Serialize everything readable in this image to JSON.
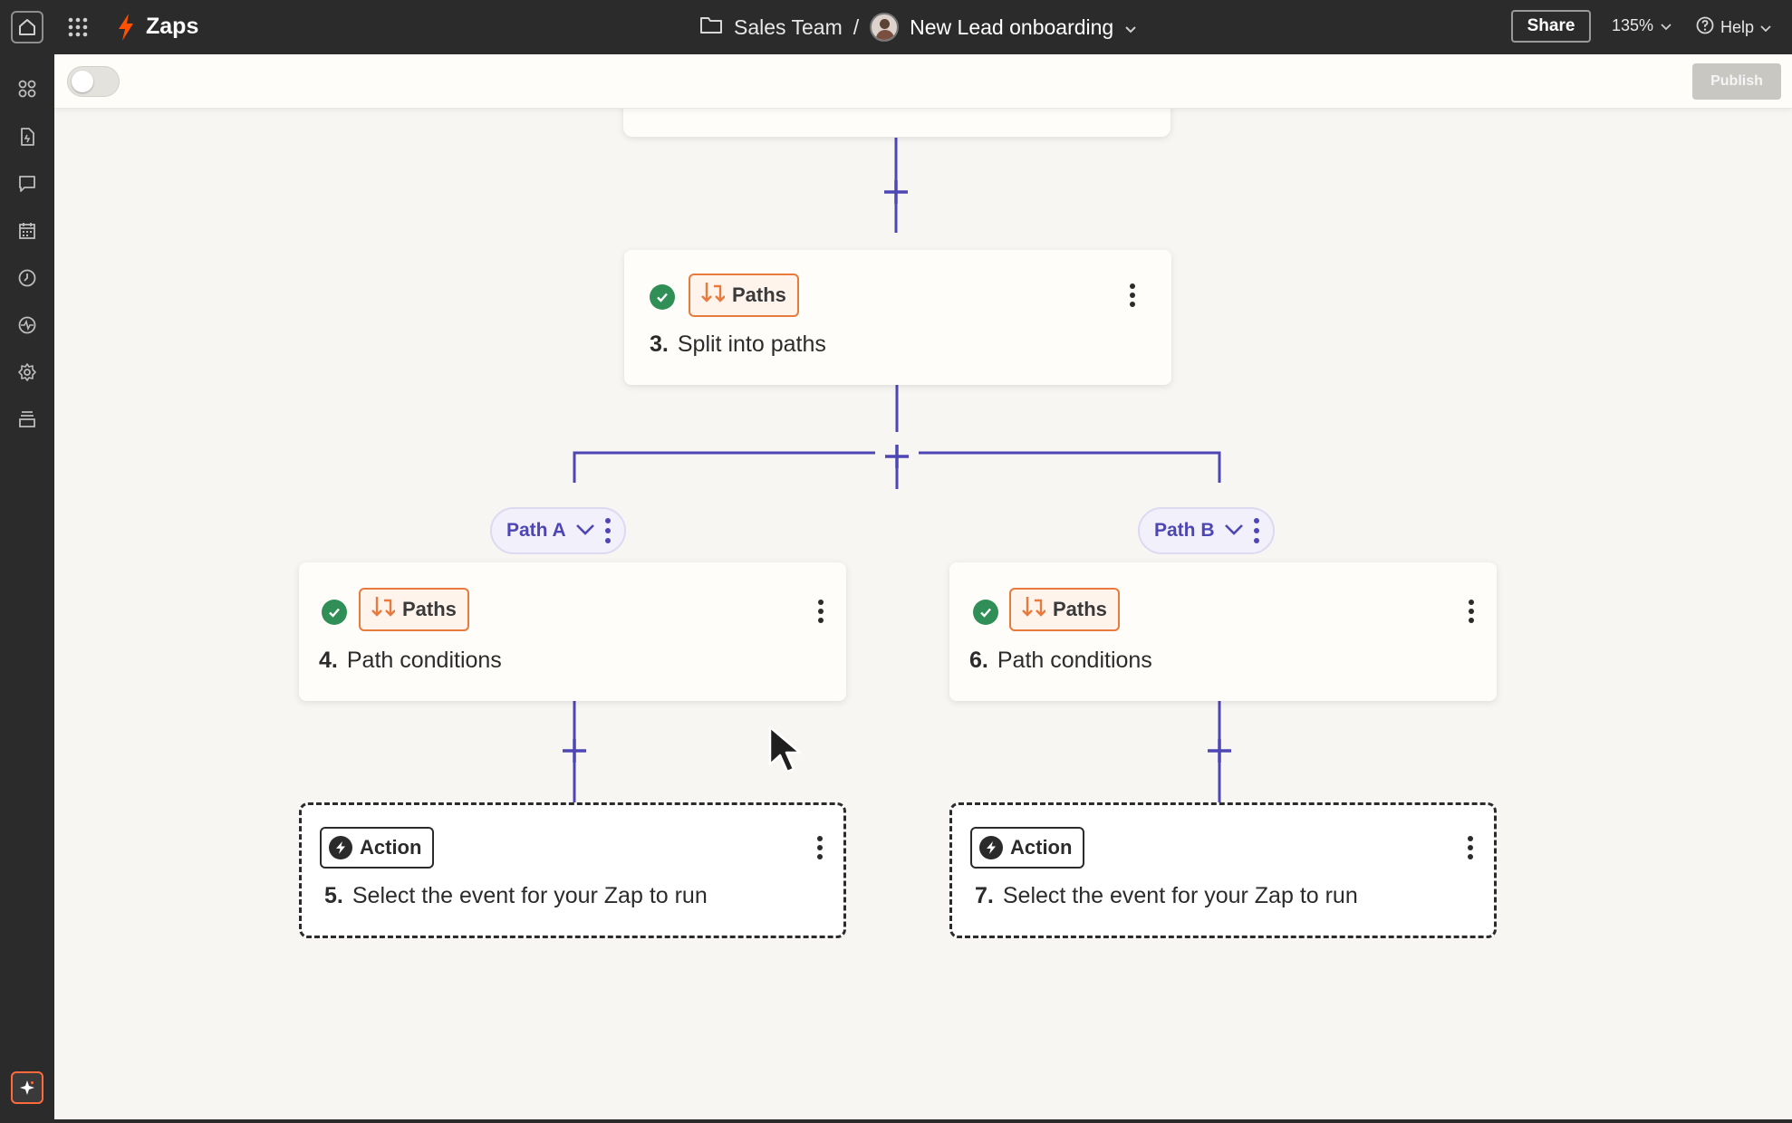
{
  "app": {
    "title": "Zaps",
    "accent_color": "#ff4f00"
  },
  "breadcrumb": {
    "folder": "Sales Team",
    "separator": "/",
    "zap_name": "New Lead onboarding"
  },
  "topbar": {
    "share_label": "Share",
    "zoom": "135%",
    "help_label": "Help"
  },
  "sidebar": {
    "icons": [
      "apps-icon",
      "document-icon",
      "chat-icon",
      "calendar-icon",
      "history-icon",
      "activity-icon",
      "settings-icon",
      "archive-icon",
      "ai-spark-icon"
    ]
  },
  "toolbar": {
    "publish_label": "Publish",
    "toggle_on": false
  },
  "steps": [
    {
      "number": "3.",
      "badge": "Paths",
      "title": "Split into paths",
      "status": "complete"
    },
    {
      "number": "4.",
      "badge": "Paths",
      "title": "Path conditions",
      "status": "complete"
    },
    {
      "number": "6.",
      "badge": "Paths",
      "title": "Path conditions",
      "status": "complete"
    },
    {
      "number": "5.",
      "badge": "Action",
      "title": "Select the event for your Zap to run",
      "status": "incomplete"
    },
    {
      "number": "7.",
      "badge": "Action",
      "title": "Select the event for your Zap to run",
      "status": "incomplete"
    }
  ],
  "paths": [
    {
      "label": "Path A"
    },
    {
      "label": "Path B"
    }
  ],
  "colors": {
    "connector": "#4e46b4",
    "paths_badge": "#e77a3c",
    "success": "#2f8f56"
  }
}
